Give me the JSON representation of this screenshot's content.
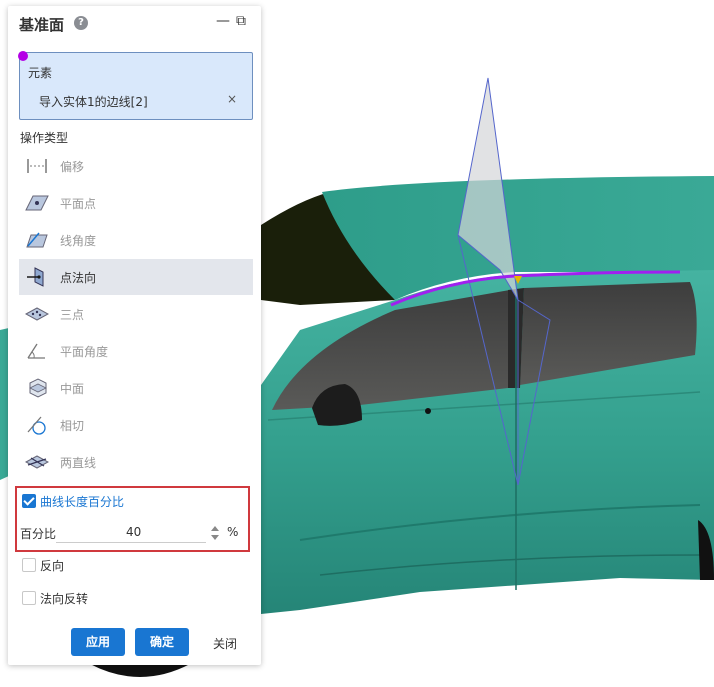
{
  "panel": {
    "title": "基准面",
    "help_icon": "?",
    "minimize_icon": "—",
    "restore_icon": "⧉",
    "element_section_label": "元素",
    "selected_element": "导入实体1的边线[2]",
    "remove_icon": "×",
    "operation_type_label": "操作类型",
    "operations": [
      {
        "label": "偏移",
        "icon": "offset-icon"
      },
      {
        "label": "平面点",
        "icon": "plane-point-icon"
      },
      {
        "label": "线角度",
        "icon": "line-angle-icon"
      },
      {
        "label": "点法向",
        "icon": "point-normal-icon",
        "selected": true
      },
      {
        "label": "三点",
        "icon": "three-points-icon"
      },
      {
        "label": "平面角度",
        "icon": "plane-angle-icon"
      },
      {
        "label": "中面",
        "icon": "mid-plane-icon"
      },
      {
        "label": "相切",
        "icon": "tangent-icon"
      },
      {
        "label": "两直线",
        "icon": "two-lines-icon"
      }
    ],
    "curve_length_percent_label": "曲线长度百分比",
    "curve_length_percent_checked": true,
    "percent_label": "百分比",
    "percent_value": "40",
    "percent_unit": "%",
    "reverse_label": "反向",
    "reverse_checked": false,
    "normal_flip_label": "法向反转",
    "normal_flip_checked": false,
    "apply_button": "应用",
    "ok_button": "确定",
    "close_button": "关闭"
  },
  "colors": {
    "accent": "#1976d2",
    "highlight_box": "#d0393e",
    "car_body": "#35a391",
    "selected_edge": "#a020f0",
    "plane_outline": "#5566cc"
  }
}
